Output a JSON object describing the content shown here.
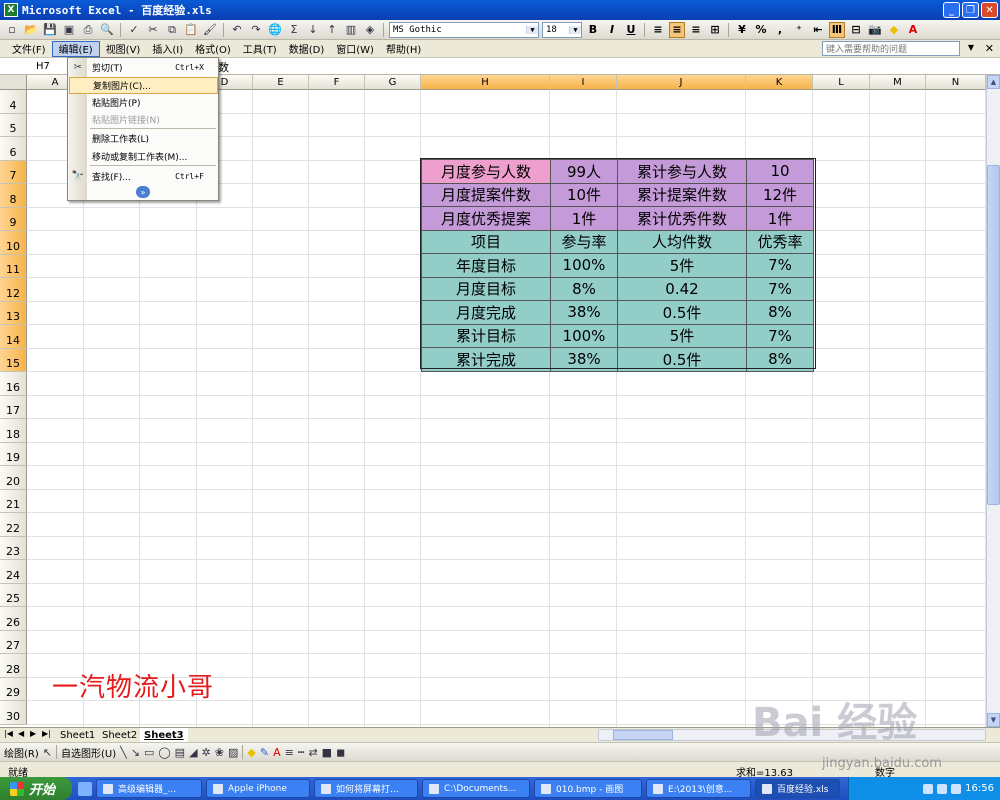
{
  "window": {
    "title": "Microsoft Excel - 百度经验.xls",
    "icon": "excel-icon"
  },
  "toolbar": {
    "font_name": "MS Gothic",
    "font_size": "18",
    "zoom_label": "%",
    "bold": "B",
    "italic": "I",
    "underline": "U"
  },
  "menubar": {
    "items": [
      "文件(F)",
      "编辑(E)",
      "视图(V)",
      "插入(I)",
      "格式(O)",
      "工具(T)",
      "数据(D)",
      "窗口(W)",
      "帮助(H)"
    ],
    "open_item": "编辑(E)",
    "help_placeholder": "键入需要帮助的问题"
  },
  "formula_bar": {
    "name_box": "H7",
    "content_tail": "数"
  },
  "edit_menu": {
    "items": [
      {
        "label": "剪切(T)",
        "shortcut": "Ctrl+X",
        "icon": "scissors-icon",
        "enabled": true,
        "highlighted": false
      },
      {
        "label": "复制图片(C)...",
        "shortcut": "",
        "icon": "",
        "enabled": true,
        "highlighted": true
      },
      {
        "label": "粘贴图片(P)",
        "shortcut": "",
        "icon": "",
        "enabled": true,
        "highlighted": false
      },
      {
        "label": "粘贴图片链接(N)",
        "shortcut": "",
        "icon": "",
        "enabled": false,
        "highlighted": false
      },
      {
        "label": "删除工作表(L)",
        "shortcut": "",
        "icon": "",
        "enabled": true,
        "highlighted": false
      },
      {
        "label": "移动或复制工作表(M)...",
        "shortcut": "",
        "icon": "",
        "enabled": true,
        "highlighted": false
      },
      {
        "label": "查找(F)...",
        "shortcut": "Ctrl+F",
        "icon": "binoculars-icon",
        "enabled": true,
        "highlighted": false
      }
    ],
    "expand_icon": "chevron-double-down-icon"
  },
  "grid": {
    "columns": [
      "A",
      "B",
      "C",
      "D",
      "E",
      "F",
      "G",
      "H",
      "I",
      "J",
      "K",
      "L",
      "M",
      "N"
    ],
    "selected_columns": [
      "H",
      "I",
      "J",
      "K"
    ],
    "rows": [
      4,
      5,
      6,
      7,
      8,
      9,
      10,
      11,
      12,
      13,
      14,
      15,
      16,
      17,
      18,
      19,
      20,
      21,
      22,
      23,
      24,
      25,
      26,
      27,
      28,
      29,
      30
    ],
    "selected_rows": [
      7,
      8,
      9,
      10,
      11,
      12,
      13,
      14,
      15
    ]
  },
  "table": {
    "rows": [
      [
        {
          "text": "月度参与人数",
          "bg": "#ee9fce"
        },
        {
          "text": "99人",
          "bg": "#c49bd8"
        },
        {
          "text": "累计参与人数",
          "bg": "#c49bd8"
        },
        {
          "text": "10",
          "bg": "#c49bd8"
        }
      ],
      [
        {
          "text": "月度提案件数",
          "bg": "#c49bd8"
        },
        {
          "text": "10件",
          "bg": "#c49bd8"
        },
        {
          "text": "累计提案件数",
          "bg": "#c49bd8"
        },
        {
          "text": "12件",
          "bg": "#c49bd8"
        }
      ],
      [
        {
          "text": "月度优秀提案",
          "bg": "#c49bd8"
        },
        {
          "text": "1件",
          "bg": "#c49bd8"
        },
        {
          "text": "累计优秀件数",
          "bg": "#c49bd8"
        },
        {
          "text": "1件",
          "bg": "#c49bd8"
        }
      ],
      [
        {
          "text": "项目",
          "bg": "#93cdc8"
        },
        {
          "text": "参与率",
          "bg": "#93cdc8"
        },
        {
          "text": "人均件数",
          "bg": "#93cdc8"
        },
        {
          "text": "优秀率",
          "bg": "#93cdc8"
        }
      ],
      [
        {
          "text": "年度目标",
          "bg": "#93cdc8"
        },
        {
          "text": "100%",
          "bg": "#93cdc8"
        },
        {
          "text": "5件",
          "bg": "#93cdc8"
        },
        {
          "text": "7%",
          "bg": "#93cdc8"
        }
      ],
      [
        {
          "text": "月度目标",
          "bg": "#93cdc8"
        },
        {
          "text": "8%",
          "bg": "#93cdc8"
        },
        {
          "text": "0.42",
          "bg": "#93cdc8"
        },
        {
          "text": "7%",
          "bg": "#93cdc8"
        }
      ],
      [
        {
          "text": "月度完成",
          "bg": "#93cdc8"
        },
        {
          "text": "38%",
          "bg": "#93cdc8"
        },
        {
          "text": "0.5件",
          "bg": "#93cdc8"
        },
        {
          "text": "8%",
          "bg": "#93cdc8"
        }
      ],
      [
        {
          "text": "累计目标",
          "bg": "#93cdc8"
        },
        {
          "text": "100%",
          "bg": "#93cdc8"
        },
        {
          "text": "5件",
          "bg": "#93cdc8"
        },
        {
          "text": "7%",
          "bg": "#93cdc8"
        }
      ],
      [
        {
          "text": "累计完成",
          "bg": "#93cdc8"
        },
        {
          "text": "38%",
          "bg": "#93cdc8"
        },
        {
          "text": "0.5件",
          "bg": "#93cdc8"
        },
        {
          "text": "8%",
          "bg": "#93cdc8"
        }
      ]
    ]
  },
  "overlay_text": "一汽物流小哥",
  "sheet_tabs": [
    "Sheet1",
    "Sheet2",
    "Sheet3"
  ],
  "active_sheet": "Sheet3",
  "drawing_toolbar": {
    "draw_label": "绘图(R)",
    "autoshape_label": "自选图形(U)"
  },
  "status_bar": {
    "status": "就绪",
    "sum": "求和=13.63",
    "mode": "数字"
  },
  "taskbar": {
    "start_label": "开始",
    "tasks": [
      "高级编辑器_...",
      "Apple iPhone",
      "如何将屏幕打...",
      "C:\\Documents...",
      "010.bmp - 画图",
      "E:\\2013\\创意...",
      "百度经验.xls"
    ],
    "active_task": "百度经验.xls",
    "clock": "16:56"
  },
  "watermark": {
    "brand": "Bai 经验",
    "url": "jingyan.baidu.com"
  }
}
